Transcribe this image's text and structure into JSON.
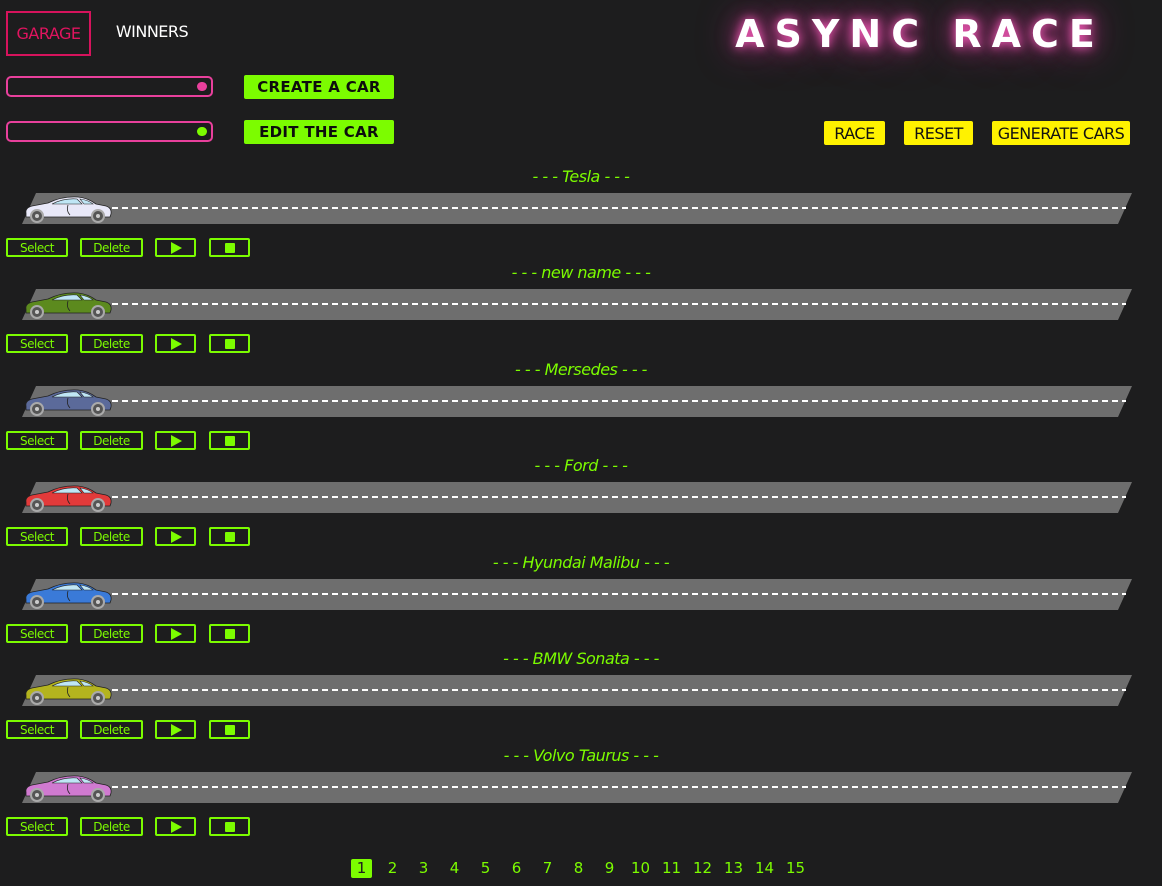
{
  "header": {
    "garage_tab": "GARAGE",
    "winners_tab": "WINNERS",
    "logo": "ASYNC RACE"
  },
  "create": {
    "value": "",
    "color": "#e8409c",
    "button": "CREATE A CAR"
  },
  "edit": {
    "value": "",
    "color": "#7cfc00",
    "button": "EDIT THE CAR"
  },
  "race_controls": {
    "race": "RACE",
    "reset": "RESET",
    "generate": "GENERATE CARS"
  },
  "cars": [
    {
      "name": "- - - Tesla - - -",
      "color": "#e8e8f8"
    },
    {
      "name": "- - - new name - - -",
      "color": "#5c8a1e"
    },
    {
      "name": "- - - Mersedes - - -",
      "color": "#5b6a9a"
    },
    {
      "name": "- - - Ford - - -",
      "color": "#e23a3a"
    },
    {
      "name": "- - - Hyundai Malibu - - -",
      "color": "#3a7ad8"
    },
    {
      "name": "- - - BMW Sonata - - -",
      "color": "#b4b41e"
    },
    {
      "name": "- - - Volvo Taurus - - -",
      "color": "#d07ad0"
    }
  ],
  "car_controls": {
    "select": "Select",
    "delete": "Delete"
  },
  "pagination": {
    "current": "1",
    "pages": [
      "1",
      "2",
      "3",
      "4",
      "5",
      "6",
      "7",
      "8",
      "9",
      "10",
      "11",
      "12",
      "13",
      "14",
      "15"
    ]
  }
}
